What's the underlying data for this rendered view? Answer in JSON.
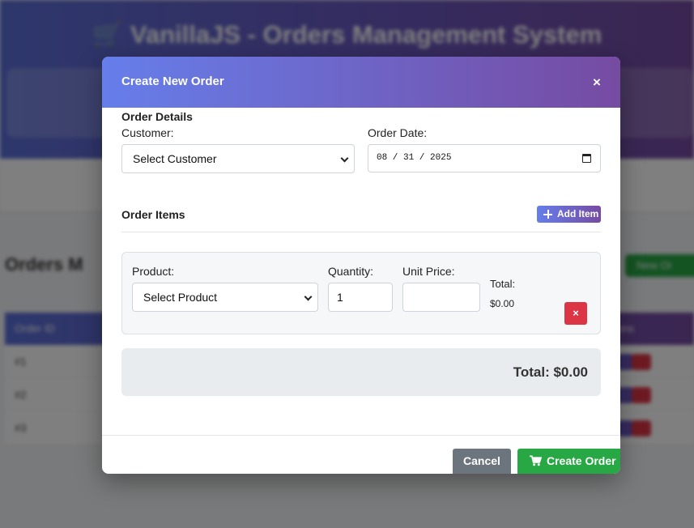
{
  "background": {
    "app_title": "🛒 VanillaJS - Orders Management System",
    "section_title": "Orders M",
    "new_order_label": "New Or",
    "table_header_first": "Order ID",
    "table_header_last": "ons",
    "rows": [
      "#1",
      "#2",
      "#3"
    ]
  },
  "modal": {
    "title": "Create New Order",
    "close_glyph": "×",
    "order_details_heading": "Order Details",
    "customer_label": "Customer:",
    "customer_value": "Select Customer",
    "order_date_label": "Order Date:",
    "order_date_value": "08 / 31 / 2025",
    "order_items_heading": "Order Items",
    "add_item_label": "Add Item",
    "item": {
      "product_label": "Product:",
      "product_value": "Select Product",
      "quantity_label": "Quantity:",
      "quantity_value": "1",
      "unit_price_label": "Unit Price:",
      "unit_price_value": "",
      "total_label": "Total:",
      "total_value": "$0.00",
      "remove_glyph": "×"
    },
    "grand_total": "Total: $0.00",
    "cancel_label": "Cancel",
    "create_label": "Create Order"
  },
  "colors": {
    "header_gradient_start": "#667eea",
    "header_gradient_end": "#764ba2",
    "success": "#28a745",
    "danger": "#dc3545",
    "secondary": "#6c757d"
  },
  "icons": {
    "close": "close-icon",
    "add": "plus-icon",
    "remove": "close-icon",
    "create": "cart-icon",
    "select": "chevron-down-icon",
    "date": "calendar-icon"
  }
}
